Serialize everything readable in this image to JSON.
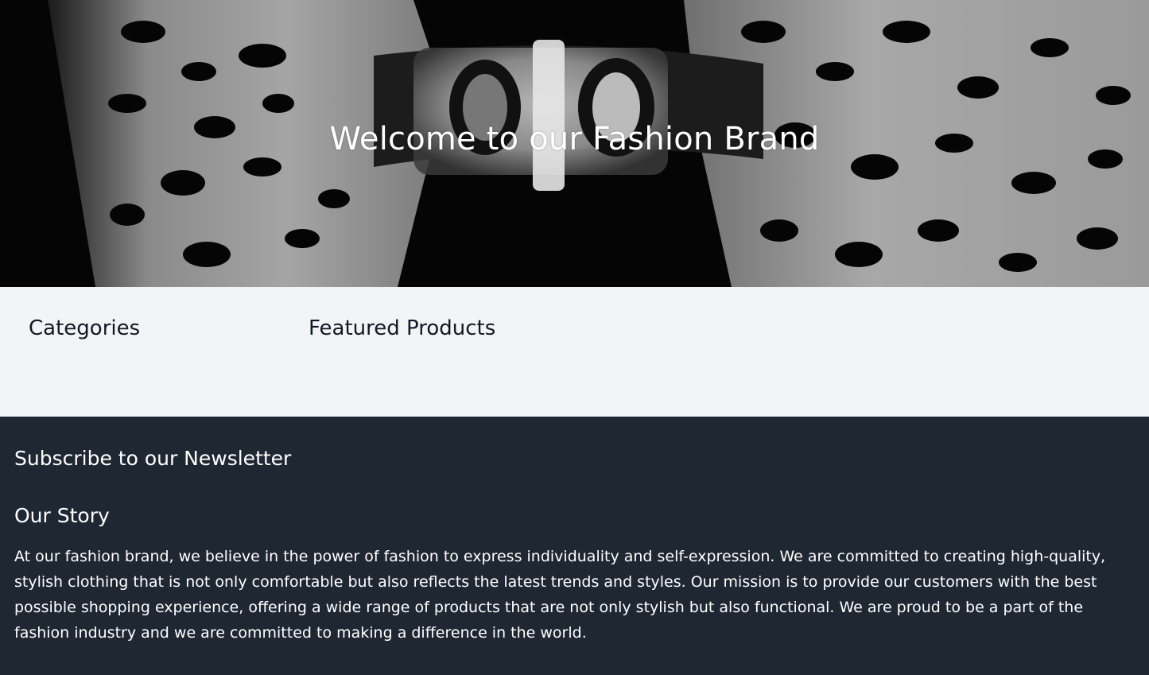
{
  "hero": {
    "title": "Welcome to our Fashion Brand"
  },
  "main": {
    "categories_title": "Categories",
    "featured_title": "Featured Products"
  },
  "footer": {
    "newsletter_title": "Subscribe to our Newsletter",
    "story_title": "Our Story",
    "story_text": "At our fashion brand, we believe in the power of fashion to express individuality and self-expression. We are committed to creating high-quality, stylish clothing that is not only comfortable but also reflects the latest trends and styles. Our mission is to provide our customers with the best possible shopping experience, offering a wide range of products that are not only stylish but also functional. We are proud to be a part of the fashion industry and we are committed to making a difference in the world."
  },
  "colors": {
    "main_bg": "#f3f4f6",
    "footer_bg": "#1f2733",
    "text_dark": "#111827",
    "text_light": "#ffffff"
  }
}
